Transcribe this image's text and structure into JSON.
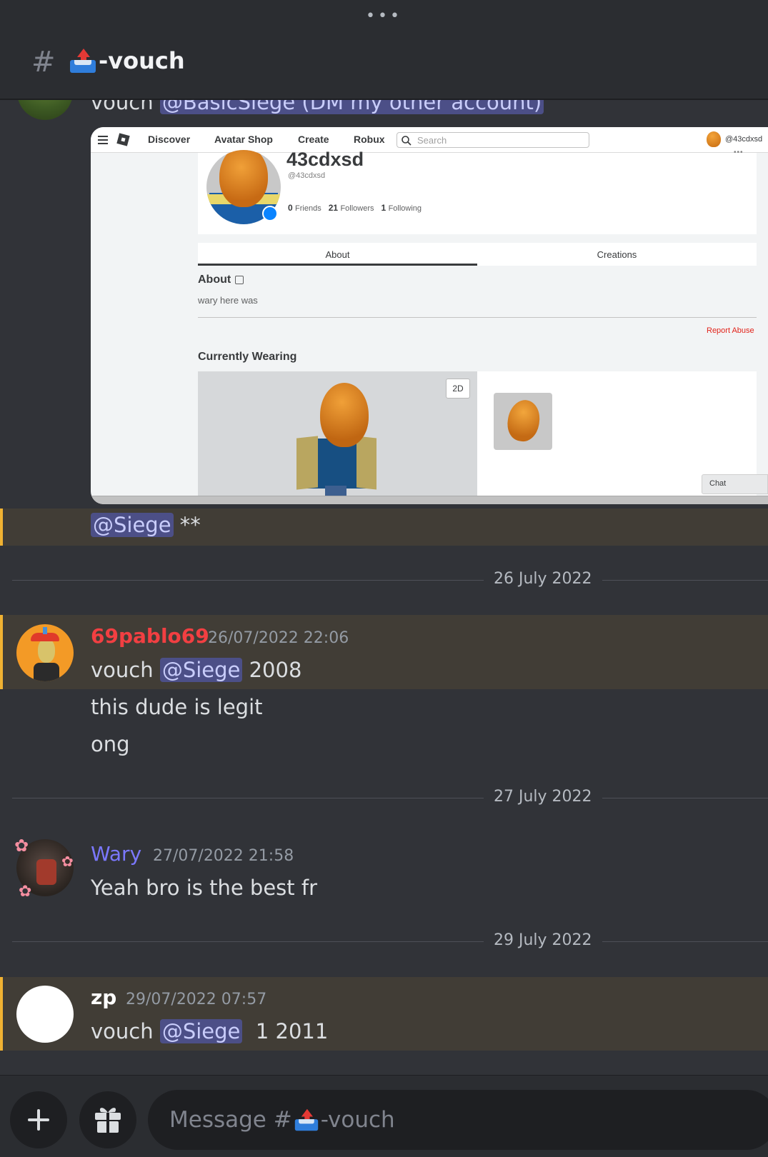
{
  "header": {
    "menu_dots": "•••",
    "hash_symbol": "#",
    "channel_suffix": "-vouch"
  },
  "first_message": {
    "prefix": "vouch ",
    "mention": "@BasicSiege (DM my other account)"
  },
  "screenshot": {
    "nav": {
      "discover": "Discover",
      "avatar_shop": "Avatar Shop",
      "create": "Create",
      "robux": "Robux",
      "search_placeholder": "Search",
      "user": "@43cdxsd"
    },
    "profile": {
      "name": "43cdxsd",
      "handle": "@43cdxsd",
      "friends_count": "0",
      "friends_label": "Friends",
      "followers_count": "21",
      "followers_label": "Followers",
      "following_count": "1",
      "following_label": "Following"
    },
    "tabs": {
      "about": "About",
      "creations": "Creations"
    },
    "about_heading": "About",
    "about_text": "wary here was",
    "report_abuse": "Report Abuse",
    "currently_wearing": "Currently Wearing",
    "toggle_2d": "2D",
    "chat": "Chat"
  },
  "continued_message": {
    "mention": "@Siege",
    "suffix": " **"
  },
  "dividers": [
    "26 July 2022",
    "27 July 2022",
    "29 July 2022"
  ],
  "messages": [
    {
      "username": "69pablo69",
      "timestamp": "26/07/2022 22:06",
      "line1_prefix": "vouch ",
      "line1_mention": "@Siege",
      "line1_suffix": " 2008",
      "line2": "this dude is legit",
      "line3": "ong",
      "color": "#f23f42"
    },
    {
      "username": "Wary",
      "timestamp": "27/07/2022 21:58",
      "text": "Yeah bro is the best fr",
      "color": "#7b78ff"
    },
    {
      "username": "zp",
      "timestamp": "29/07/2022 07:57",
      "prefix": "vouch ",
      "mention": "@Siege",
      "suffix": "  1 2011",
      "color": "#ffffff"
    }
  ],
  "composer": {
    "placeholder_prefix": "Message #",
    "placeholder_suffix": "-vouch"
  },
  "icons": [
    "plus-icon",
    "gift-icon",
    "inbox-tray-icon",
    "hamburger-icon",
    "roblox-logo-icon",
    "search-icon",
    "edit-icon"
  ]
}
